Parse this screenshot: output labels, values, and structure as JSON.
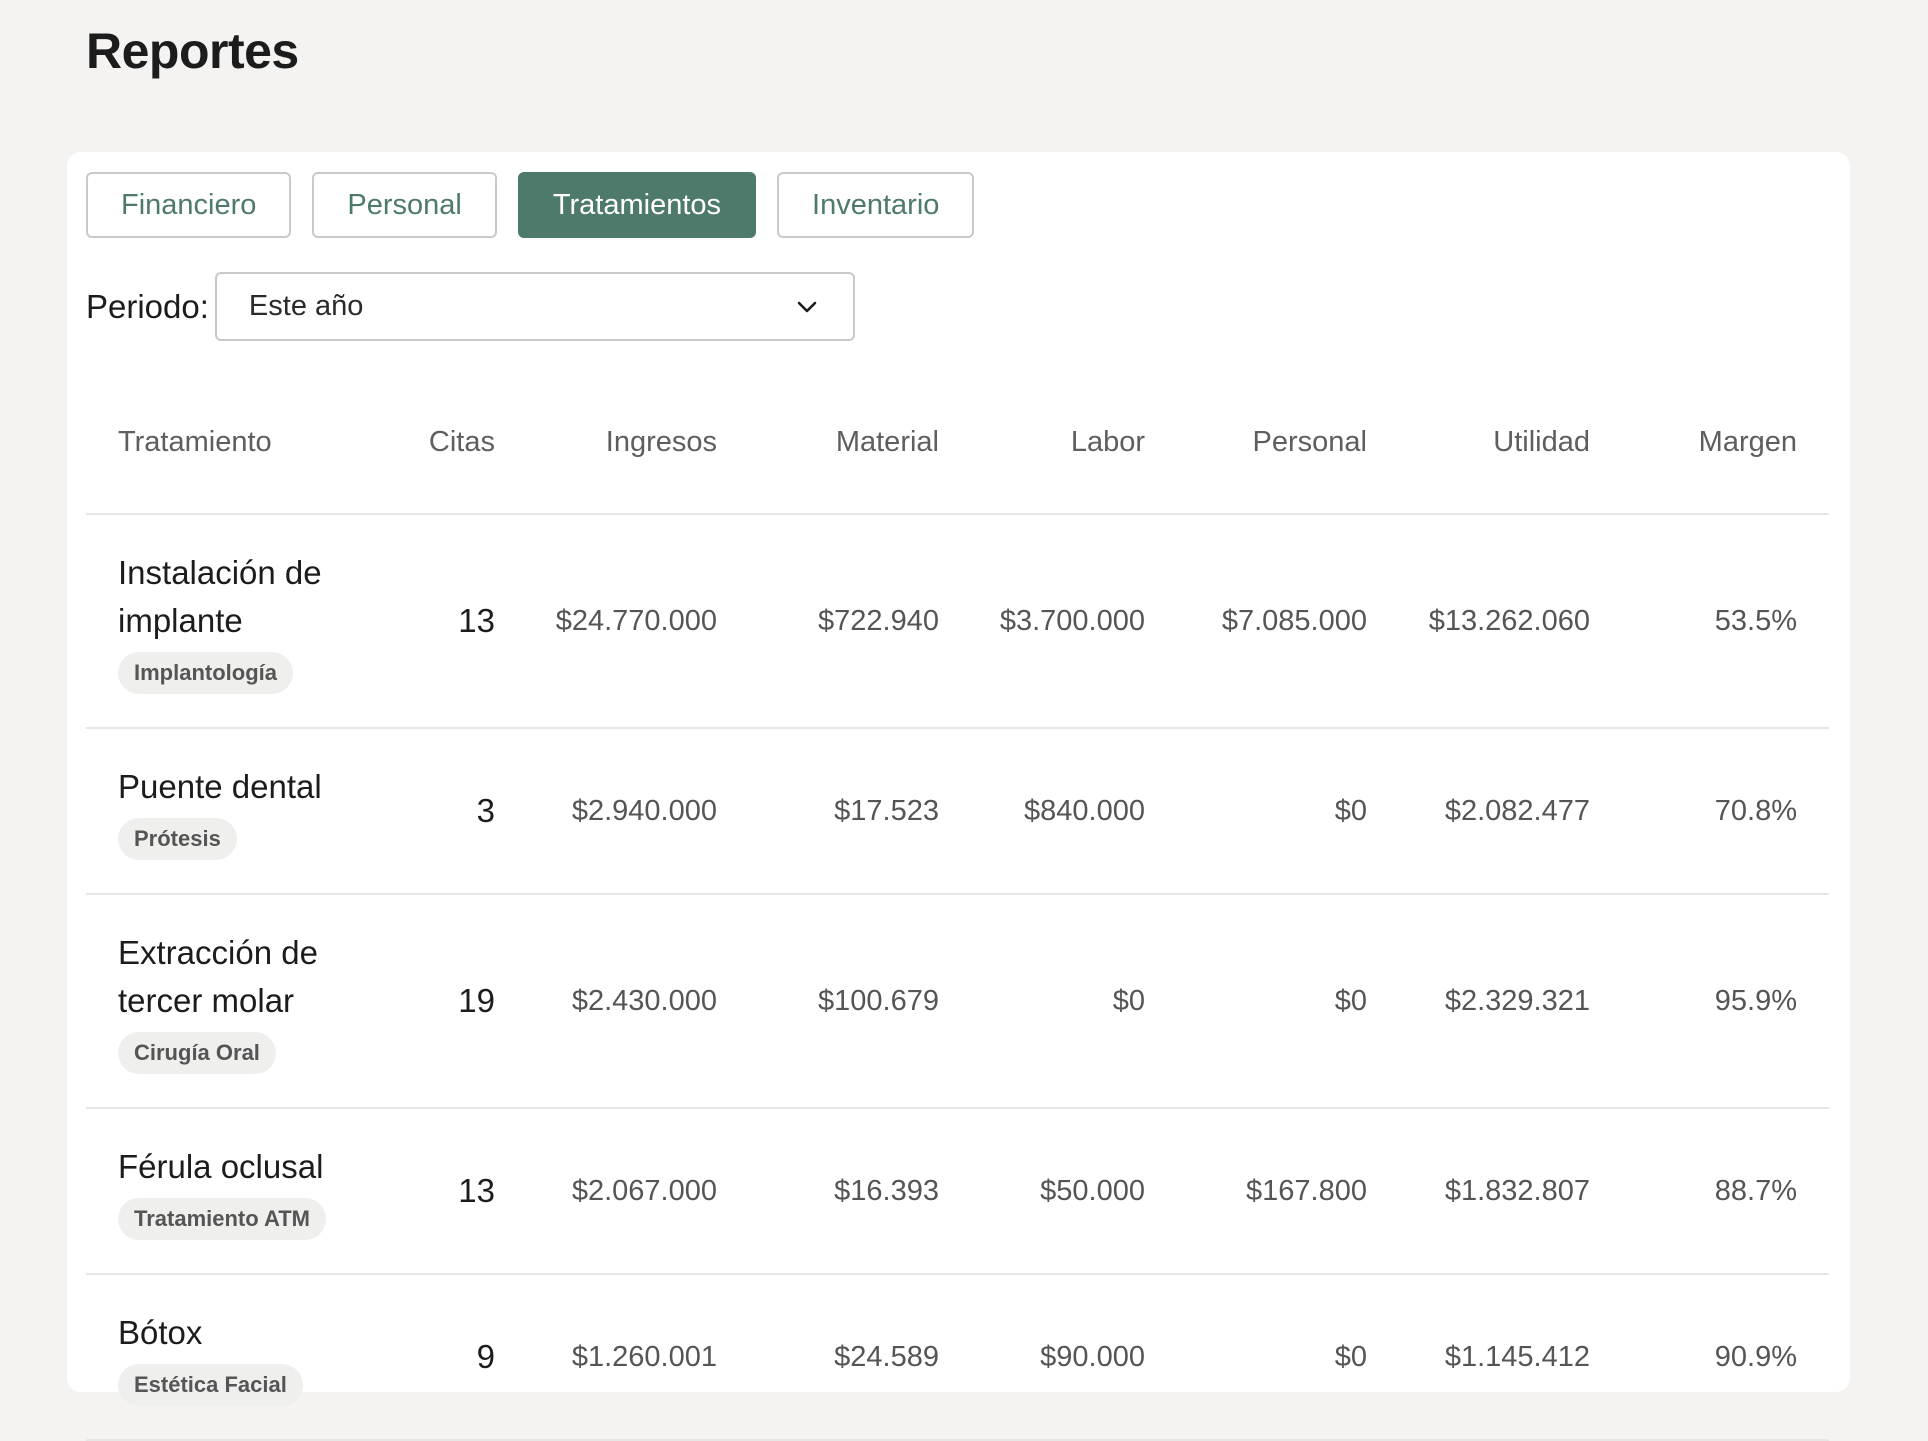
{
  "page": {
    "title": "Reportes"
  },
  "tabs": [
    {
      "label": "Financiero",
      "active": false
    },
    {
      "label": "Personal",
      "active": false
    },
    {
      "label": "Tratamientos",
      "active": true
    },
    {
      "label": "Inventario",
      "active": false
    }
  ],
  "period": {
    "label": "Periodo:",
    "selected": "Este año",
    "icon": "chevron-down-icon"
  },
  "table": {
    "headers": {
      "treatment": "Tratamiento",
      "citas": "Citas",
      "ingresos": "Ingresos",
      "material": "Material",
      "labor": "Labor",
      "personal": "Personal",
      "utilidad": "Utilidad",
      "margen": "Margen"
    },
    "rows": [
      {
        "name": "Instalación de implante",
        "category": "Implantología",
        "citas": "13",
        "ingresos": "$24.770.000",
        "material": "$722.940",
        "labor": "$3.700.000",
        "personal": "$7.085.000",
        "utilidad": "$13.262.060",
        "margen": "53.5%"
      },
      {
        "name": "Puente dental",
        "category": "Prótesis",
        "citas": "3",
        "ingresos": "$2.940.000",
        "material": "$17.523",
        "labor": "$840.000",
        "personal": "$0",
        "utilidad": "$2.082.477",
        "margen": "70.8%"
      },
      {
        "name": "Extracción de tercer molar",
        "category": "Cirugía Oral",
        "citas": "19",
        "ingresos": "$2.430.000",
        "material": "$100.679",
        "labor": "$0",
        "personal": "$0",
        "utilidad": "$2.329.321",
        "margen": "95.9%"
      },
      {
        "name": "Férula oclusal",
        "category": "Tratamiento ATM",
        "citas": "13",
        "ingresos": "$2.067.000",
        "material": "$16.393",
        "labor": "$50.000",
        "personal": "$167.800",
        "utilidad": "$1.832.807",
        "margen": "88.7%"
      },
      {
        "name": "Bótox",
        "category": "Estética Facial",
        "citas": "9",
        "ingresos": "$1.260.001",
        "material": "$24.589",
        "labor": "$90.000",
        "personal": "$0",
        "utilidad": "$1.145.412",
        "margen": "90.9%"
      }
    ]
  },
  "colors": {
    "accent": "#4e7a6c",
    "background": "#f4f3f1",
    "card": "#ffffff",
    "badge_bg": "#efefed"
  }
}
